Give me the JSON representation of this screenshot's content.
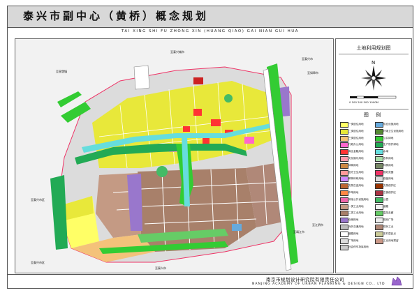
{
  "title": {
    "main": "泰兴市副中心（黄桥）概念规划",
    "pinyin": "TAI   XING   SHI   FU   ZHONG   XIN   (HUANG QIAO)   GAI   NIAN   GUI   HUA"
  },
  "legend": {
    "header": "土地利用规划图",
    "title": "图 例",
    "north_label": "N",
    "scale_label": "0 100 200 500          1000M",
    "items": [
      {
        "label": "一类居住用地",
        "color": "#ffff66"
      },
      {
        "label": "二类居住用地",
        "color": "#e8e83a"
      },
      {
        "label": "三类居住用地",
        "color": "#f4c27a"
      },
      {
        "label": "行政办公用地",
        "color": "#ff66cc"
      },
      {
        "label": "商业金融用地",
        "color": "#ff3333"
      },
      {
        "label": "文化娱乐用地",
        "color": "#ff99aa"
      },
      {
        "label": "体育用地",
        "color": "#cc8844"
      },
      {
        "label": "医疗卫生用地",
        "color": "#ff9999"
      },
      {
        "label": "教育科研用地",
        "color": "#cc88ff"
      },
      {
        "label": "文物古迹用地",
        "color": "#bb6633"
      },
      {
        "label": "市场用地",
        "color": "#ff8844"
      },
      {
        "label": "其他公共设施用地",
        "color": "#ee66aa"
      },
      {
        "label": "一类工业用地",
        "color": "#c49a84"
      },
      {
        "label": "二类工业用地",
        "color": "#a8806a"
      },
      {
        "label": "仓储用地",
        "color": "#9977cc"
      },
      {
        "label": "对外交通用地",
        "color": "#bbbbbb"
      },
      {
        "label": "道路用地",
        "color": "#ffffff"
      },
      {
        "label": "广场用地",
        "color": "#dddddd"
      },
      {
        "label": "社会停车场库用地",
        "color": "#cccccc"
      },
      {
        "label": "供应设施用地",
        "color": "#66aadd"
      },
      {
        "label": "环境卫生设施用地",
        "color": "#558833"
      },
      {
        "label": "公共绿地",
        "color": "#33cc33"
      },
      {
        "label": "生产防护绿地",
        "color": "#22aa55"
      },
      {
        "label": "水域",
        "color": "#66dddd"
      },
      {
        "label": "农林用地",
        "color": "#aaddaa"
      },
      {
        "label": "特殊用地",
        "color": "#778866"
      },
      {
        "label": "规划范围",
        "color": "#ee3366"
      },
      {
        "label": "保留用地",
        "color": "#dcdcdc"
      },
      {
        "label": "文物保护区",
        "color": "#993300"
      },
      {
        "label": "古镇保护区",
        "color": "#aa3344"
      },
      {
        "label": "公园",
        "color": "#44bb66"
      },
      {
        "label": "道路",
        "color": "#f0f0f0"
      },
      {
        "label": "高压走廊",
        "color": "#66cc66"
      },
      {
        "label": "规划广场",
        "color": "#eeeeee"
      },
      {
        "label": "现状工业",
        "color": "#b08878"
      },
      {
        "label": "农村居民点",
        "color": "#cccc99"
      },
      {
        "label": "工业用地预留",
        "color": "#cc9988"
      }
    ]
  },
  "map": {
    "road_labels": [
      {
        "text": "至泰兴城市",
        "id": "taixing-city"
      },
      {
        "text": "至泰兴市",
        "id": "taixing-north"
      },
      {
        "text": "至宣堡镇",
        "id": "xuanbao"
      },
      {
        "text": "至泰兴市区",
        "id": "taixing-west"
      },
      {
        "text": "至泰兴市区",
        "id": "taixing-sw"
      },
      {
        "text": "至泰兴市",
        "id": "taixing-south"
      },
      {
        "text": "至靖江市",
        "id": "jingjiang"
      },
      {
        "text": "至江阴市",
        "id": "jiangyin"
      },
      {
        "text": "至如皋市",
        "id": "rugao"
      }
    ]
  },
  "footer": {
    "cn": "南京市规划设计研究院有限责任公司",
    "en": "NANJING ACADEMY OF URBAN PLANNING & DESIGN CO., LTD"
  }
}
